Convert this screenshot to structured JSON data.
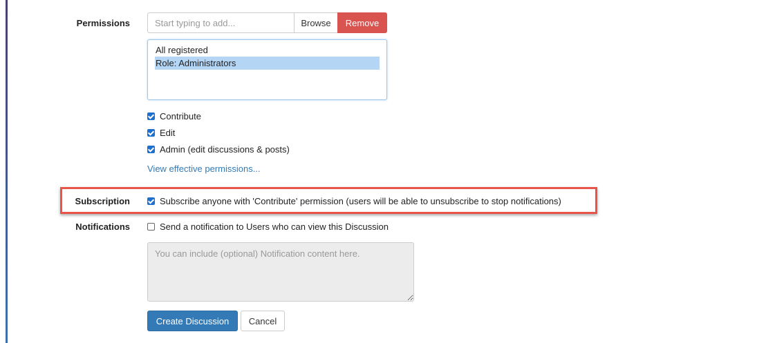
{
  "permissions": {
    "label": "Permissions",
    "input_placeholder": "Start typing to add...",
    "browse_label": "Browse",
    "remove_label": "Remove",
    "list_items": [
      {
        "text": "All registered",
        "selected": false
      },
      {
        "text": "Role: Administrators",
        "selected": true
      }
    ],
    "checkboxes": [
      {
        "label": "Contribute",
        "checked": true
      },
      {
        "label": "Edit",
        "checked": true
      },
      {
        "label": "Admin (edit discussions & posts)",
        "checked": true
      }
    ],
    "view_link": "View effective permissions..."
  },
  "subscription": {
    "label": "Subscription",
    "checkbox_label": "Subscribe anyone with 'Contribute' permission (users will be able to unsubscribe to stop notifications)",
    "checked": true
  },
  "notifications": {
    "label": "Notifications",
    "checkbox_label": "Send a notification to Users who can view this Discussion",
    "checked": false,
    "textarea_placeholder": "You can include (optional) Notification content here."
  },
  "actions": {
    "create_label": "Create Discussion",
    "cancel_label": "Cancel"
  },
  "colors": {
    "accent": "#337ab7",
    "danger": "#d9534f",
    "highlight_border": "#e8534a",
    "selection": "#b5d5f5"
  }
}
